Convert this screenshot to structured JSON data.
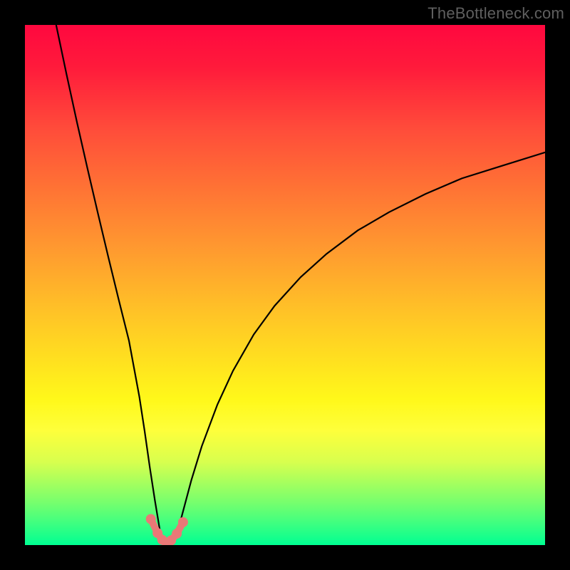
{
  "watermark": "TheBottleneck.com",
  "colors": {
    "frame": "#000000",
    "curve": "#000000",
    "marker": "#e97877",
    "gradient_top": "#ff083f",
    "gradient_bottom": "#00ff92"
  },
  "chart_data": {
    "type": "line",
    "title": "",
    "xlabel": "",
    "ylabel": "",
    "xlim": [
      0,
      100
    ],
    "ylim": [
      0,
      100
    ],
    "series": [
      {
        "name": "curve",
        "x": [
          6,
          8,
          10,
          12,
          14,
          16,
          18,
          20,
          22,
          23,
          24,
          25,
          26,
          27,
          28,
          29,
          30,
          32,
          34,
          37,
          40,
          44,
          48,
          53,
          58,
          64,
          70,
          77,
          84,
          92,
          100
        ],
        "values": [
          100,
          90.5,
          81.3,
          72.5,
          63.9,
          55.5,
          47.3,
          39.3,
          28.5,
          22.0,
          15.0,
          8.5,
          2.5,
          0.7,
          0.1,
          2.0,
          5.0,
          12.5,
          19.0,
          27.0,
          33.5,
          40.5,
          46.0,
          51.5,
          56.0,
          60.5,
          64.0,
          67.5,
          70.5,
          73.0,
          75.5
        ]
      },
      {
        "name": "markers",
        "x": [
          24.2,
          25.5,
          26.4,
          27.2,
          28.1,
          29.2,
          30.4
        ],
        "values": [
          5.0,
          2.3,
          1.0,
          0.4,
          0.9,
          2.2,
          4.4
        ]
      }
    ],
    "grid": false,
    "legend": false
  }
}
